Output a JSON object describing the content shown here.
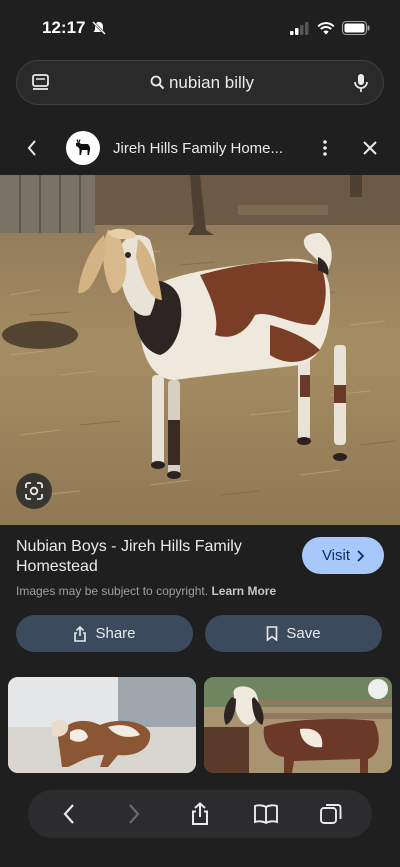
{
  "status": {
    "time": "12:17"
  },
  "search": {
    "query": "nubian billy"
  },
  "source": {
    "title": "Jireh Hills Family Home..."
  },
  "result": {
    "title": "Nubian Boys - Jireh Hills Family Homestead",
    "visit_label": "Visit",
    "copyright_text": "Images may be subject to copyright.",
    "learn_more_label": "Learn More",
    "share_label": "Share",
    "save_label": "Save"
  },
  "colors": {
    "accent": "#a8c7fa",
    "action_bg": "#3c4a5e",
    "background": "#1f1f1f"
  }
}
